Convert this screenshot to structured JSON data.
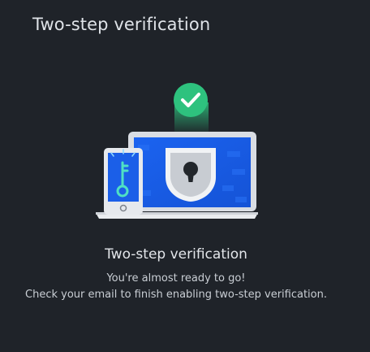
{
  "header": {
    "title": "Two-step verification"
  },
  "illustration": {
    "icons": [
      "check-icon",
      "laptop-icon",
      "lock-icon",
      "phone-icon",
      "key-icon"
    ],
    "colors": {
      "accent_green": "#2ec27e",
      "screen_blue": "#1a5ee6",
      "device_frame": "#d9dde3"
    }
  },
  "content": {
    "heading": "Two-step verification",
    "line1": "You're almost ready to go!",
    "line2": "Check your email to finish enabling two-step verification."
  }
}
